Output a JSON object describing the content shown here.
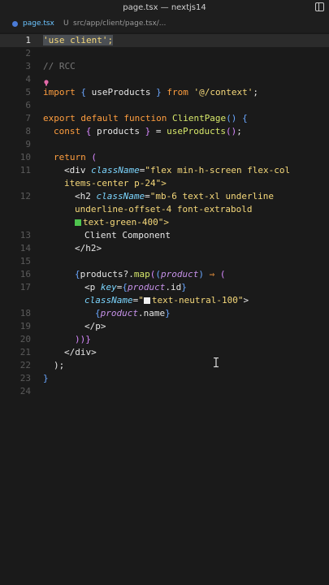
{
  "window": {
    "title": "page.tsx — nextjs14"
  },
  "tab": {
    "file": "page.tsx",
    "modified": "U",
    "path": "src/app/client/page.tsx/..."
  },
  "colors": {
    "accent": "#6bc4ff",
    "green_swatch": "#4ec44e",
    "neutral_swatch": "#f0f0f0"
  },
  "lines": [
    {
      "n": "1",
      "text": "'use client';"
    },
    {
      "n": "2",
      "text": ""
    },
    {
      "n": "3",
      "text": "// RCC"
    },
    {
      "n": "4",
      "text": ""
    },
    {
      "n": "5",
      "text": "import { useProducts } from '@/context';"
    },
    {
      "n": "6",
      "text": ""
    },
    {
      "n": "7",
      "text": "export default function ClientPage() {"
    },
    {
      "n": "8",
      "text": "const { products } = useProducts();"
    },
    {
      "n": "9",
      "text": ""
    },
    {
      "n": "10",
      "text": "return ("
    },
    {
      "n": "11",
      "text": "<div className=\"flex min-h-screen flex-col"
    },
    {
      "n": "",
      "text": "items-center p-24\">"
    },
    {
      "n": "12",
      "text": "<h2 className=\"mb-6 text-xl underline"
    },
    {
      "n": "",
      "text": "underline-offset-4 font-extrabold"
    },
    {
      "n": "",
      "text": "text-green-400\">"
    },
    {
      "n": "13",
      "text": "Client Component"
    },
    {
      "n": "14",
      "text": "</h2>"
    },
    {
      "n": "15",
      "text": ""
    },
    {
      "n": "16",
      "text": "{products?.map((product) => ("
    },
    {
      "n": "17",
      "text": "<p key={product.id}"
    },
    {
      "n": "",
      "text": "className=\"text-neutral-100\">"
    },
    {
      "n": "18",
      "text": "{product.name}"
    },
    {
      "n": "19",
      "text": "</p>"
    },
    {
      "n": "20",
      "text": "))}"
    },
    {
      "n": "21",
      "text": "</div>"
    },
    {
      "n": "22",
      "text": ");"
    },
    {
      "n": "23",
      "text": "}"
    },
    {
      "n": "24",
      "text": ""
    }
  ]
}
